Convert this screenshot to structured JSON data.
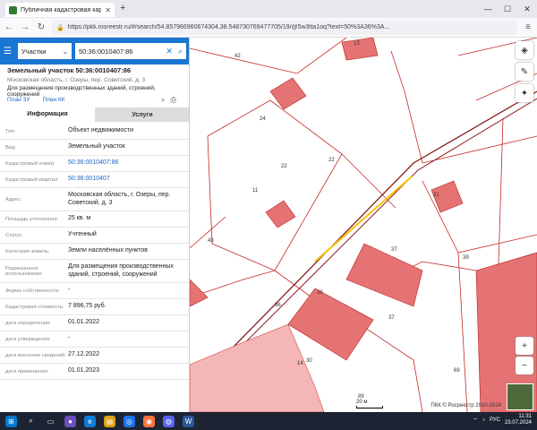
{
  "browser": {
    "tab_title": "Публичная кадастровая карта",
    "url": "https://pkk.rosreestr.ru/#/search/54.857966960674304,38.548730769477705/19/@5w3tta1oq?text=50%3A36%3A..."
  },
  "search": {
    "category": "Участки",
    "query": "50:36:0010407:86"
  },
  "object": {
    "title": "Земельный участок 50:36:0010407:86",
    "address": "Московская область, г. Озеры, пер. Советский, д. 3",
    "usage": "Для размещения производственных зданий, строений, сооружений",
    "link_plan_zu": "План ЗУ",
    "link_plan_kk": "План КК"
  },
  "tabs": {
    "info": "Информация",
    "services": "Услуги"
  },
  "properties": [
    {
      "key": "Тип:",
      "value": "Объект недвижимости"
    },
    {
      "key": "Вид:",
      "value": "Земельный участок"
    },
    {
      "key": "Кадастровый номер:",
      "value": "50:36:0010407:86"
    },
    {
      "key": "Кадастровый квартал:",
      "value": "50:36:0010407"
    },
    {
      "key": "Адрес:",
      "value": "Московская область, г. Озеры, пер. Советский, д. 3"
    },
    {
      "key": "Площадь уточненная:",
      "value": "25 кв. м"
    },
    {
      "key": "Статус:",
      "value": "Учтенный"
    },
    {
      "key": "Категория земель:",
      "value": "Земли населённых пунктов"
    },
    {
      "key": "Разрешенное использование:",
      "value": "Для размещения производственных зданий, строений, сооружений"
    },
    {
      "key": "Форма собственности:",
      "value": "-"
    },
    {
      "key": "Кадастровая стоимость:",
      "value": "7 896,75 руб."
    },
    {
      "key": "дата определения:",
      "value": "01.01.2022"
    },
    {
      "key": "дата утверждения:",
      "value": "-"
    },
    {
      "key": "дата внесения сведений:",
      "value": "27.12.2022"
    },
    {
      "key": "дата применения:",
      "value": "01.01.2023"
    }
  ],
  "map": {
    "labels": [
      "13",
      "42",
      "24",
      "22",
      "22",
      "11",
      "43",
      "37",
      "39",
      "21",
      "38",
      "36",
      "37",
      "14",
      "89",
      "30",
      "69"
    ],
    "scale": "20 м",
    "credit": "ПКК © Росреестр 2010-2024"
  },
  "taskbar": {
    "lang": "РУС",
    "time": "11:31",
    "date": "23.07.2024"
  },
  "colors": {
    "accent": "#1976d2",
    "parcel_fill": "#e57373",
    "parcel_line": "#c62828"
  }
}
